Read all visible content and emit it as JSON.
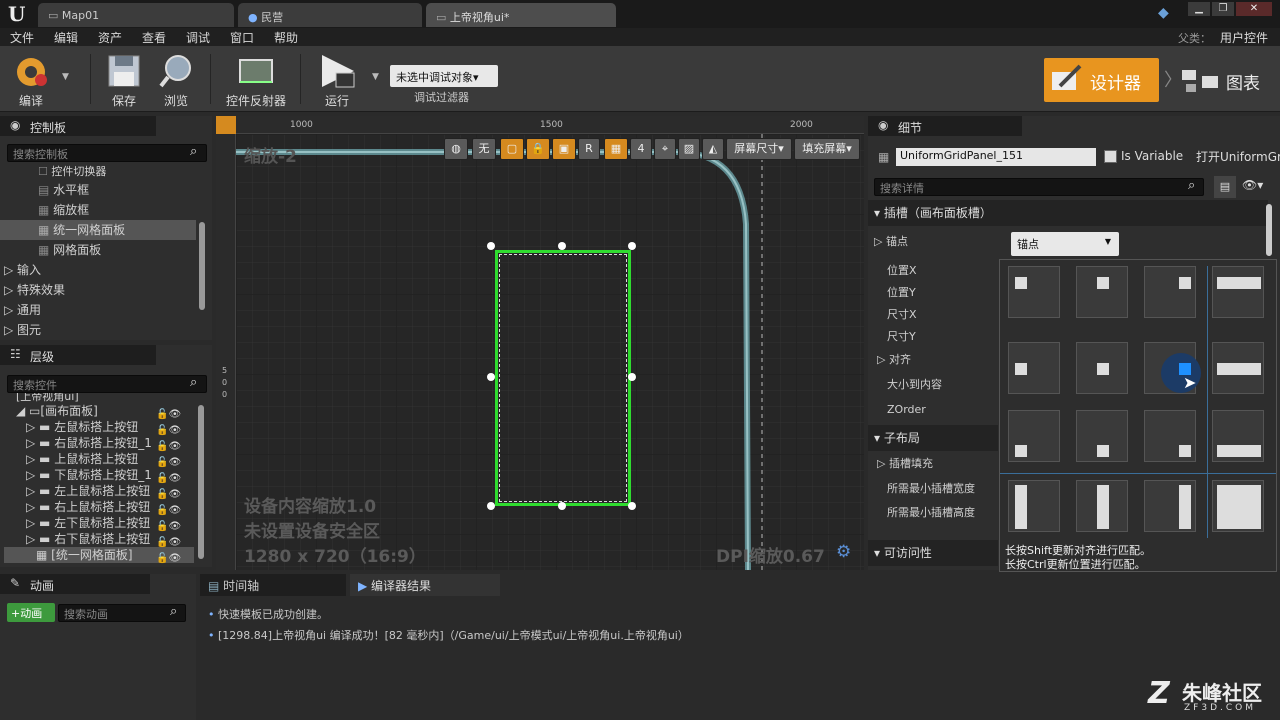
{
  "titlebar": {
    "logo": "U",
    "tabs": [
      {
        "label": "Map01"
      },
      {
        "label": "民营"
      },
      {
        "label": "上帝视角ui*"
      }
    ],
    "parent_class_label": "父类：",
    "parent_class_value": "用户控件"
  },
  "menu": [
    "文件",
    "编辑",
    "资产",
    "查看",
    "调试",
    "窗口",
    "帮助"
  ],
  "toolbar": {
    "compile": "编译",
    "save": "保存",
    "browse": "浏览",
    "widget_reflector": "控件反射器",
    "run": "运行",
    "debug_select": "未选中调试对象▾",
    "debug_filter": "调试过滤器",
    "designer": "设计器",
    "graph": "图表"
  },
  "palette": {
    "title": "控制板",
    "search_placeholder": "搜索控制板",
    "items": [
      "控件切换器",
      "水平框",
      "缩放框",
      "统一网格面板",
      "网格面板"
    ],
    "categories": [
      "输入",
      "特殊效果",
      "通用",
      "图元"
    ]
  },
  "hierarchy": {
    "title": "层级",
    "search_placeholder": "搜索控件",
    "root": "[上帝视角ui]",
    "canvas": "[画布面板]",
    "items": [
      "左鼠标搭上按钮",
      "右鼠标搭上按钮_1",
      "上鼠标搭上按钮",
      "下鼠标搭上按钮_1",
      "左上鼠标搭上按钮",
      "右上鼠标搭上按钮",
      "左下鼠标搭上按钮",
      "右下鼠标搭上按钮"
    ],
    "selected": "[统一网格面板]"
  },
  "viewport": {
    "ruler": [
      "1000",
      "1500",
      "2000"
    ],
    "ruler_left": [
      "5",
      "0",
      "0"
    ],
    "zoom": "缩放-2",
    "toolbar": {
      "none": "无",
      "r": "R",
      "grid_num": "4",
      "screen_size": "屏幕尺寸▾",
      "fill_screen": "填充屏幕▾"
    },
    "info_scale": "设备内容缩放1.0",
    "info_safe": "未设置设备安全区",
    "info_res": "1280 x 720（16:9）",
    "dpi": "DPI缩放0.67"
  },
  "details": {
    "title": "细节",
    "name_value": "UniformGridPanel_151",
    "is_variable": "Is Variable",
    "open": "打开UniformGr",
    "search_placeholder": "搜索详情",
    "slot_section": "插槽（画布面板槽）",
    "anchor_label": "锚点",
    "anchor_dropdown": "锚点",
    "props": [
      "位置X",
      "位置Y",
      "尺寸X",
      "尺寸Y",
      "对齐",
      "大小到内容",
      "ZOrder"
    ],
    "child_layout": "子布局",
    "slot_fill": "插槽填充",
    "min_width": "所需最小插槽宽度",
    "min_height": "所需最小插槽高度",
    "accessibility": "可访问性",
    "hint1": "长按Shift更新对齐进行匹配。",
    "hint2": "长按Ctrl更新位置进行匹配。"
  },
  "bottom": {
    "animation_tab": "动画",
    "add_animation": "+动画",
    "search_animation": "搜索动画",
    "timeline_tab": "时间轴",
    "compiler_tab": "编译器结果",
    "log": [
      "快速模板已成功创建。",
      "[1298.84]上帝视角ui 编译成功！[82 毫秒内]（/Game/ui/上帝模式ui/上帝视角ui.上帝视角ui）"
    ]
  },
  "watermark": {
    "brand": "朱峰社区",
    "url": "ZF3D.COM"
  },
  "colors": {
    "accent_orange": "#e8951f",
    "selection_green": "#2fdc2f",
    "highlight_blue": "#1e90ff"
  }
}
